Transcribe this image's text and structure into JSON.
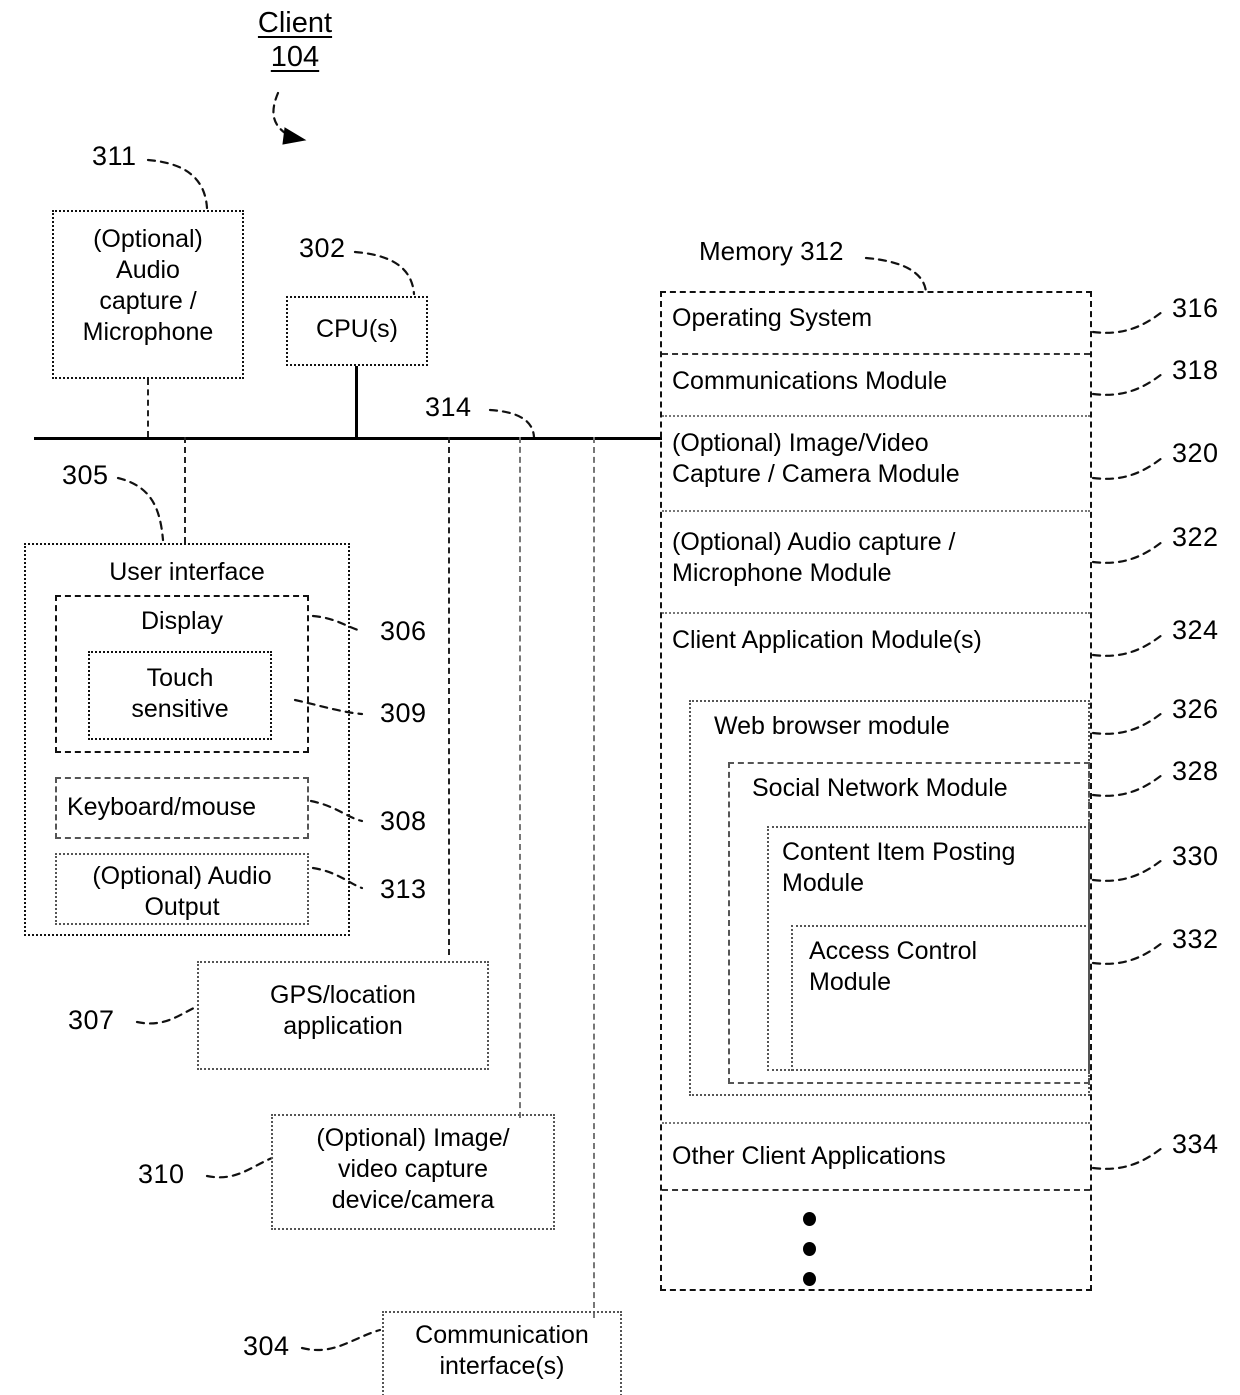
{
  "figure": {
    "title_line1": "Client",
    "title_line2": "104"
  },
  "left_column": {
    "audio_capture": {
      "ref": "311",
      "label": "(Optional)\nAudio\ncapture /\nMicrophone"
    },
    "cpu": {
      "ref": "302",
      "label": "CPU(s)"
    },
    "bus": {
      "ref": "314"
    },
    "user_interface": {
      "ref": "305",
      "label": "User interface",
      "display": {
        "ref": "306",
        "label": "Display"
      },
      "touch_sensitive": {
        "ref": "309",
        "label": "Touch\nsensitive"
      },
      "keyboard_mouse": {
        "ref": "308",
        "label": "Keyboard/mouse"
      },
      "audio_output": {
        "ref": "313",
        "label": "(Optional) Audio\nOutput"
      }
    },
    "gps": {
      "ref": "307",
      "label": "GPS/location\napplication"
    },
    "image_capture": {
      "ref": "310",
      "label": "(Optional) Image/\nvideo capture\ndevice/camera"
    },
    "communication_interface": {
      "ref": "304",
      "label": "Communication\ninterface(s)"
    }
  },
  "memory": {
    "heading": "Memory 312",
    "rows": [
      {
        "ref": "316",
        "label": "Operating System"
      },
      {
        "ref": "318",
        "label": "Communications Module"
      },
      {
        "ref": "320",
        "label": "(Optional) Image/Video\nCapture / Camera Module"
      },
      {
        "ref": "322",
        "label": "(Optional) Audio capture /\nMicrophone Module"
      },
      {
        "ref": "324",
        "label": "Client Application Module(s)"
      },
      {
        "ref": "326",
        "label": "Web browser module"
      },
      {
        "ref": "328",
        "label": "Social Network Module"
      },
      {
        "ref": "330",
        "label": "Content Item Posting\nModule"
      },
      {
        "ref": "332",
        "label": "Access Control\nModule"
      },
      {
        "ref": "334",
        "label": "Other Client Applications"
      }
    ],
    "ellipsis": "three-vertical-dots"
  }
}
